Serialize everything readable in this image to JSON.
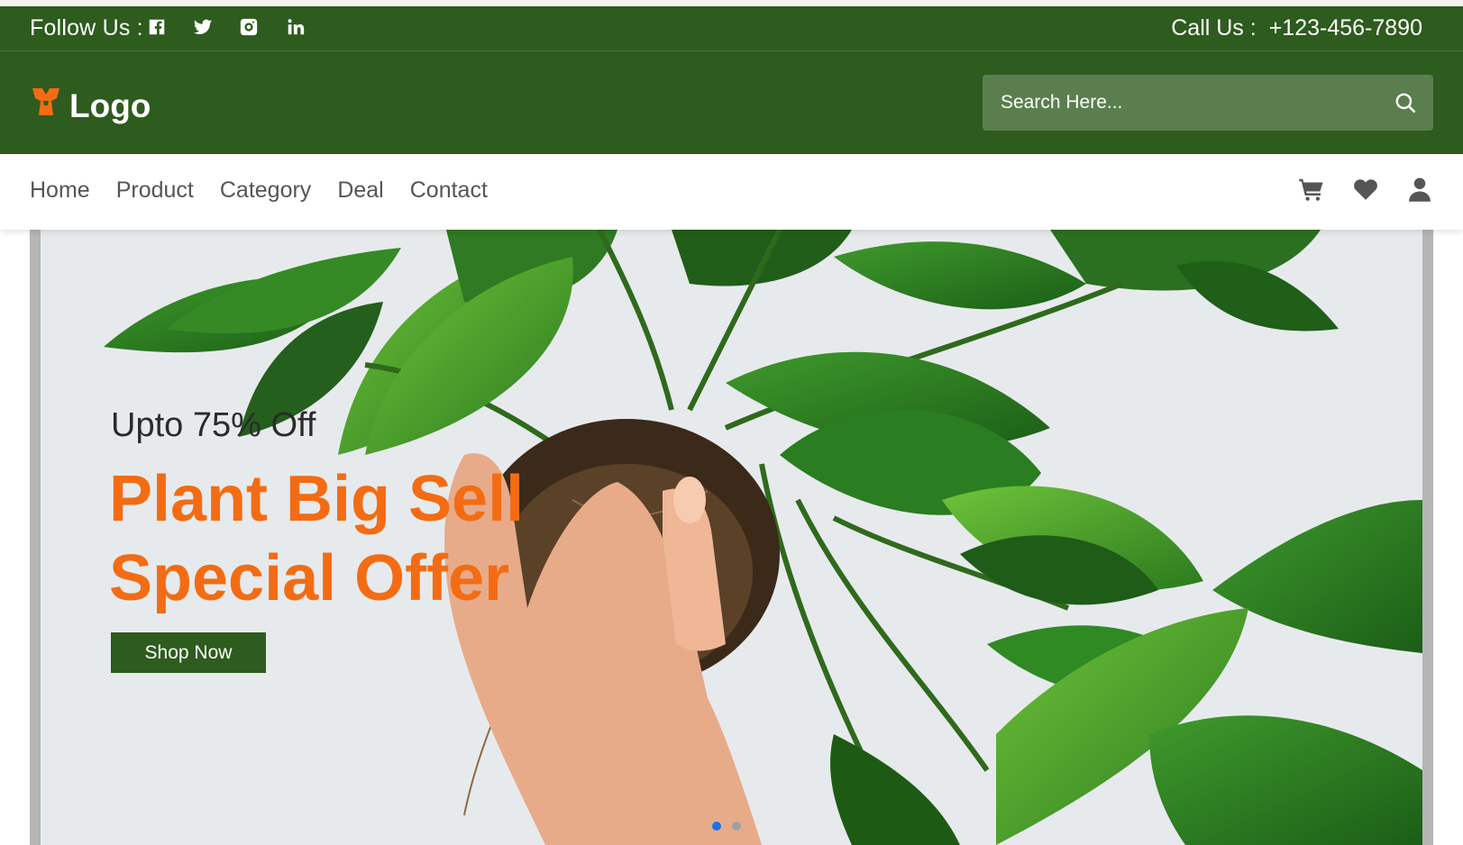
{
  "topbar": {
    "follow_label": "Follow Us :",
    "social": [
      {
        "name": "facebook-icon"
      },
      {
        "name": "twitter-icon"
      },
      {
        "name": "instagram-icon"
      },
      {
        "name": "linkedin-icon"
      }
    ],
    "call_label": "Call Us :",
    "phone": "+123-456-7890"
  },
  "header": {
    "logo_text": "Logo",
    "logo_icon": "logo-icon",
    "search": {
      "placeholder": "Search Here...",
      "icon": "search-icon"
    }
  },
  "nav": {
    "items": [
      {
        "label": "Home"
      },
      {
        "label": "Product"
      },
      {
        "label": "Category"
      },
      {
        "label": "Deal"
      },
      {
        "label": "Contact"
      }
    ],
    "icons": [
      "cart-icon",
      "heart-icon",
      "user-icon"
    ]
  },
  "hero": {
    "subtitle": "Upto 75% Off",
    "title_line1": "Plant Big Sell",
    "title_line2": "Special Offer",
    "cta_label": "Shop Now",
    "carousel": {
      "active_index": 0,
      "count": 2
    }
  },
  "colors": {
    "brand_green": "#2e5b1e",
    "accent_orange": "#f36c14",
    "search_bg": "#5b7e4f",
    "carousel_active": "#1a73e8"
  }
}
